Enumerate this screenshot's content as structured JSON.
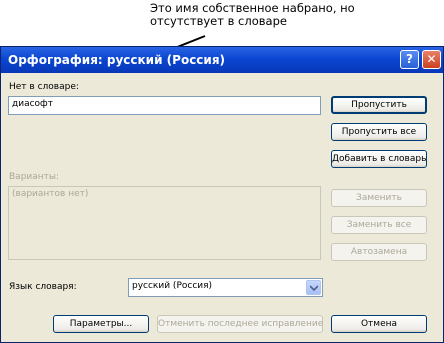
{
  "annotation": {
    "line1": "Это имя собственное набрано, но",
    "line2": "отсутствует в словаре"
  },
  "dialog": {
    "title": "Орфография: русский (Россия)",
    "help_label": "?",
    "close_label": "✕"
  },
  "not_in_dictionary": {
    "label": "Нет в словаре:",
    "value": "диасофт"
  },
  "suggestions": {
    "label": "Варианты:",
    "value": "(вариантов нет)"
  },
  "dictionary_language": {
    "label": "Язык словаря:",
    "value": "русский (Россия)"
  },
  "buttons": {
    "skip": "Пропустить",
    "skip_all": "Пропустить все",
    "add_to_dictionary": "Добавить в словарь",
    "replace": "Заменить",
    "replace_all": "Заменить все",
    "autocorrect": "Автозамена",
    "options": "Параметры...",
    "undo_last": "Отменить последнее исправление",
    "cancel": "Отмена"
  }
}
